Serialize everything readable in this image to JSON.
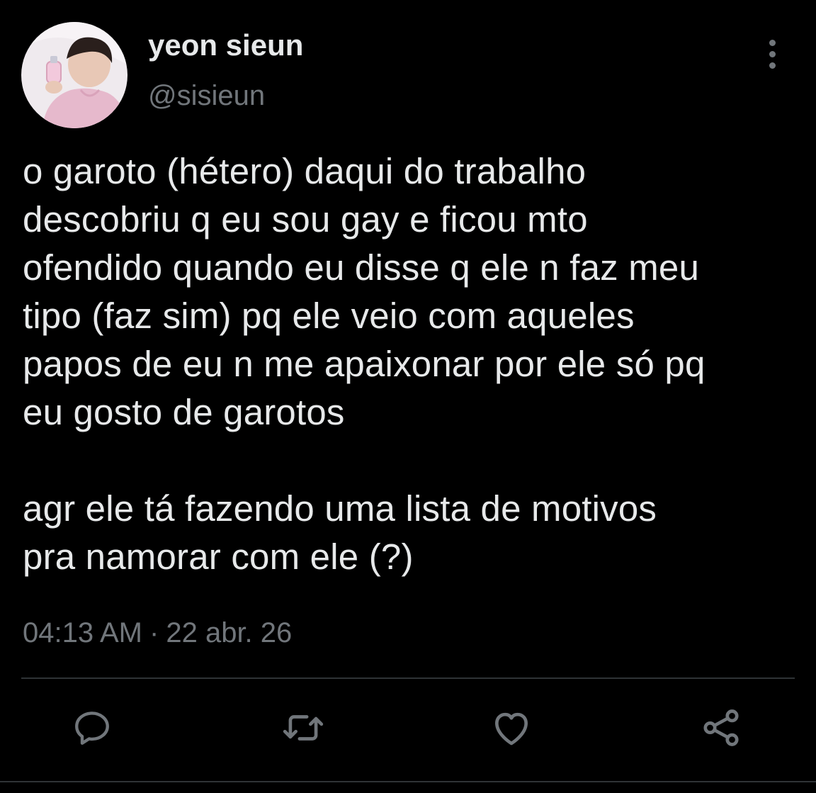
{
  "tweet": {
    "author": {
      "display_name": "yeon sieun",
      "handle": "@sisieun",
      "avatar_icon": "profile-photo"
    },
    "paragraphs": [
      "o garoto (hétero) daqui do trabalho\ndescobriu q eu sou gay e ficou mto\nofendido quando eu disse q ele n faz meu\ntipo (faz sim) pq ele veio com aqueles\npapos de eu n me apaixonar por ele só pq\neu gosto de garotos",
      "agr ele tá fazendo uma lista de motivos\npra namorar com ele (?)"
    ],
    "time": "04:13 AM",
    "separator": "·",
    "date": "22 abr. 26"
  },
  "actions": [
    {
      "icon": "reply-icon"
    },
    {
      "icon": "retweet-icon"
    },
    {
      "icon": "like-icon"
    },
    {
      "icon": "share-icon"
    }
  ],
  "colors": {
    "background": "#000000",
    "text": "#e7e9ea",
    "secondary_text": "#71767b",
    "divider": "#2f3336"
  }
}
